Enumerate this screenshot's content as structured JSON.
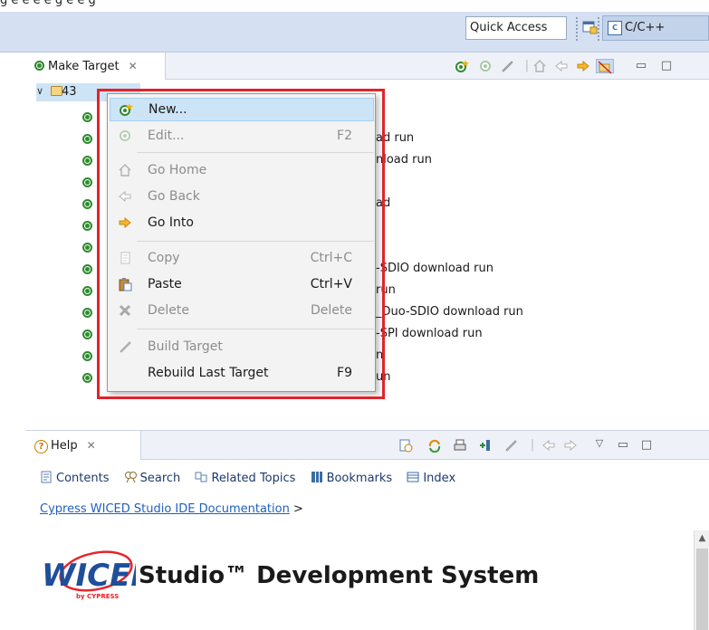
{
  "toolbar": {
    "quick_access": "Quick Access",
    "perspective": "C/C++",
    "icons": [
      "open-perspective-icon",
      "c-cpp-perspective-icon"
    ]
  },
  "make_target": {
    "tab_label": "Make Target",
    "tree_root_label": "43",
    "view_icons": [
      "new-target-icon",
      "edit-target-icon",
      "build-target-icon",
      "go-home-icon",
      "go-back-icon",
      "go-into-icon",
      "hide-empty-folders-icon",
      "minimize-icon",
      "maximize-icon"
    ],
    "partial_labels": [
      "ad run",
      "nload run",
      "ad",
      "-SDIO download run",
      "run",
      "_Duo-SDIO download run",
      "-SPI download run",
      "n",
      "un"
    ]
  },
  "context_menu": {
    "items": [
      {
        "icon": "new-target-icon",
        "label": "New...",
        "shortcut": "",
        "enabled": true,
        "highlighted": true
      },
      {
        "icon": "edit-target-icon",
        "label": "Edit...",
        "shortcut": "F2",
        "enabled": false
      },
      {
        "icon": "home-icon",
        "label": "Go Home",
        "shortcut": "",
        "enabled": false
      },
      {
        "icon": "back-arrow-icon",
        "label": "Go Back",
        "shortcut": "",
        "enabled": false
      },
      {
        "icon": "forward-arrow-icon",
        "label": "Go Into",
        "shortcut": "",
        "enabled": true
      },
      {
        "icon": "copy-icon",
        "label": "Copy",
        "shortcut": "Ctrl+C",
        "enabled": false
      },
      {
        "icon": "paste-icon",
        "label": "Paste",
        "shortcut": "Ctrl+V",
        "enabled": true
      },
      {
        "icon": "delete-icon",
        "label": "Delete",
        "shortcut": "Delete",
        "enabled": false
      },
      {
        "icon": "build-icon",
        "label": "Build Target",
        "shortcut": "",
        "enabled": false
      },
      {
        "icon": "",
        "label": "Rebuild Last Target",
        "shortcut": "F9",
        "enabled": true
      }
    ]
  },
  "help": {
    "tab_label": "Help",
    "links": {
      "contents": "Contents",
      "search": "Search",
      "related_topics": "Related Topics",
      "bookmarks": "Bookmarks",
      "index": "Index"
    },
    "breadcrumb_link": "Cypress WICED Studio IDE Documentation",
    "breadcrumb_sep": ">",
    "logo_text": "WICED",
    "logo_sub": "by CYPRESS",
    "hero_title": "Studio™ Development System"
  },
  "colors": {
    "toolbar_bg": "#d5e1f2",
    "selection": "#cde4f7",
    "annotation_red": "#e0242b",
    "target_green": "#2e8b2e",
    "link_blue": "#1f5fbf"
  }
}
